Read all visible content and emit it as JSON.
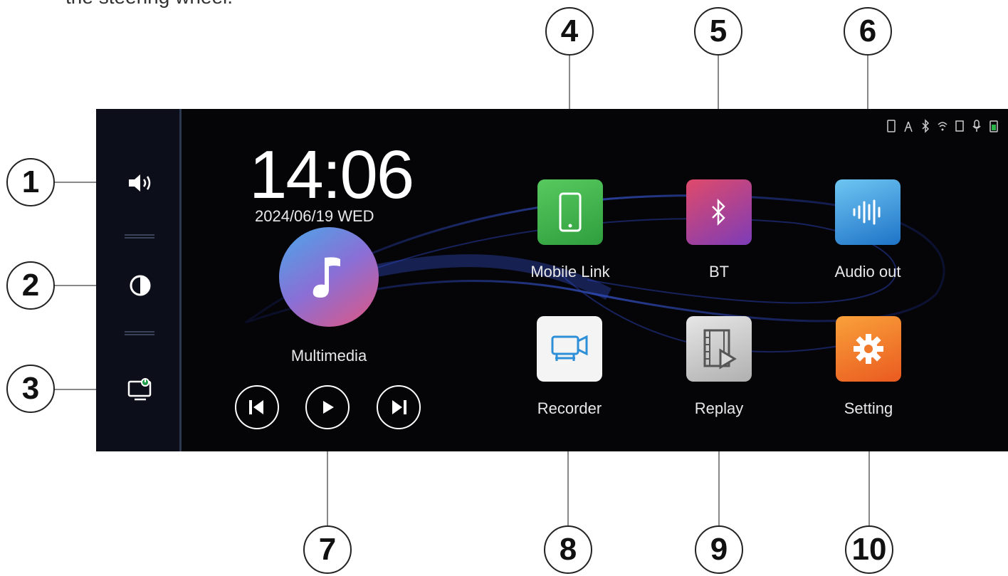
{
  "caption_partial": "the steering wheel.",
  "callouts": [
    "1",
    "2",
    "3",
    "4",
    "5",
    "6",
    "7",
    "8",
    "9",
    "10"
  ],
  "status_icons": [
    "phone-signal-icon",
    "antenna-icon",
    "bluetooth-status-icon",
    "wifi-icon",
    "sd-card-icon",
    "microphone-icon",
    "battery-icon"
  ],
  "sidebar": {
    "items": [
      {
        "icon": "volume-icon",
        "color": "#3b6fd0"
      },
      {
        "icon": "brightness-icon",
        "color": "#b23a38"
      },
      {
        "icon": "screen-off-icon",
        "color": "#1f9b4a"
      }
    ]
  },
  "clock": {
    "time": "14:06",
    "date": "2024/06/19 WED"
  },
  "multimedia": {
    "label": "Multimedia"
  },
  "apps": [
    {
      "label": "Mobile Link",
      "icon": "mobile-icon",
      "color": "#3bb54a"
    },
    {
      "label": "BT",
      "icon": "bluetooth-icon",
      "color": "#b8388d"
    },
    {
      "label": "Audio out",
      "icon": "waveform-icon",
      "color": "#2f90d8"
    },
    {
      "label": "Recorder",
      "icon": "camera-icon",
      "color": "#f2f2f2"
    },
    {
      "label": "Replay",
      "icon": "film-icon",
      "color": "#c9c9c9"
    },
    {
      "label": "Setting",
      "icon": "gear-icon",
      "color": "#f07a2c"
    }
  ]
}
